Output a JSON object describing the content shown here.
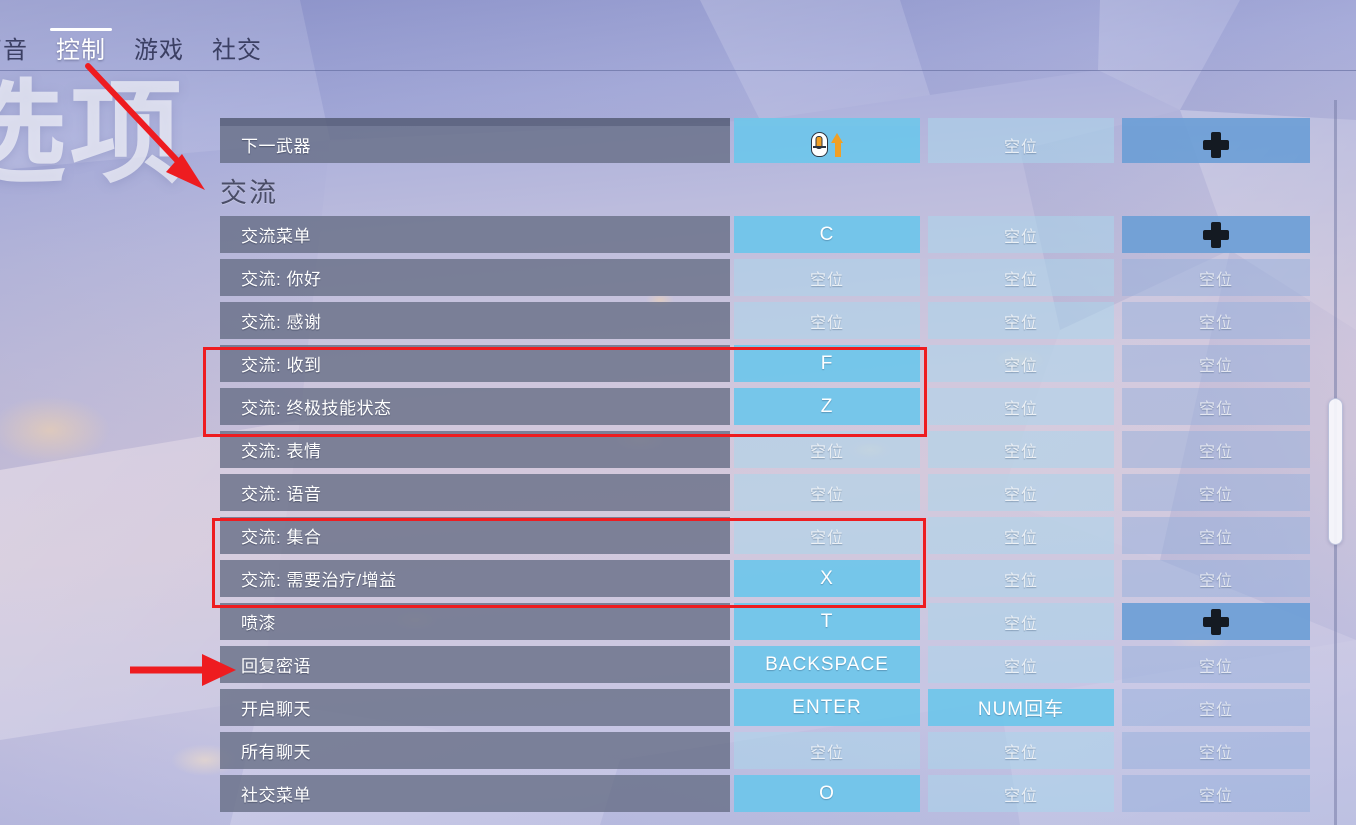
{
  "window": {
    "title": "选项"
  },
  "tabs": [
    {
      "label": "声音",
      "active": false
    },
    {
      "label": "控制",
      "active": true
    },
    {
      "label": "游戏",
      "active": false
    },
    {
      "label": "社交",
      "active": false
    }
  ],
  "empty_label": "空位",
  "icons": {
    "mouse_scroll_up": "mouse-scroll-up-icon",
    "dpad": "dpad-icon"
  },
  "colors": {
    "accent_blue": "#6ec6ea",
    "pad_blue": "#6c9ed6",
    "row_gray": "#676e86",
    "annotation_red": "#ee1c20",
    "active_tab": "#ffffff"
  },
  "partial_row_top": true,
  "rows": [
    {
      "type": "binding",
      "label": "下一武器",
      "keys": [
        {
          "kind": "icon",
          "icon": "mouse-scroll-up-icon",
          "state": "bound"
        },
        {
          "kind": "text",
          "text": "空位",
          "state": "empty"
        },
        {
          "kind": "icon",
          "icon": "dpad-icon",
          "state": "pad"
        }
      ]
    },
    {
      "type": "section",
      "label": "交流"
    },
    {
      "type": "binding",
      "label": "交流菜单",
      "keys": [
        {
          "kind": "text",
          "text": "C",
          "state": "bound"
        },
        {
          "kind": "text",
          "text": "空位",
          "state": "empty"
        },
        {
          "kind": "icon",
          "icon": "dpad-icon",
          "state": "pad"
        }
      ]
    },
    {
      "type": "binding",
      "label": "交流: 你好",
      "keys": [
        {
          "kind": "text",
          "text": "空位",
          "state": "empty"
        },
        {
          "kind": "text",
          "text": "空位",
          "state": "empty"
        },
        {
          "kind": "text",
          "text": "空位",
          "state": "empty3"
        }
      ]
    },
    {
      "type": "binding",
      "label": "交流: 感谢",
      "keys": [
        {
          "kind": "text",
          "text": "空位",
          "state": "empty"
        },
        {
          "kind": "text",
          "text": "空位",
          "state": "empty"
        },
        {
          "kind": "text",
          "text": "空位",
          "state": "empty3"
        }
      ]
    },
    {
      "type": "binding",
      "label": "交流: 收到",
      "highlighted": true,
      "keys": [
        {
          "kind": "text",
          "text": "F",
          "state": "bound"
        },
        {
          "kind": "text",
          "text": "空位",
          "state": "empty"
        },
        {
          "kind": "text",
          "text": "空位",
          "state": "empty3"
        }
      ]
    },
    {
      "type": "binding",
      "label": "交流: 终极技能状态",
      "highlighted": true,
      "keys": [
        {
          "kind": "text",
          "text": "Z",
          "state": "bound"
        },
        {
          "kind": "text",
          "text": "空位",
          "state": "empty"
        },
        {
          "kind": "text",
          "text": "空位",
          "state": "empty3"
        }
      ]
    },
    {
      "type": "binding",
      "label": "交流: 表情",
      "keys": [
        {
          "kind": "text",
          "text": "空位",
          "state": "empty"
        },
        {
          "kind": "text",
          "text": "空位",
          "state": "empty"
        },
        {
          "kind": "text",
          "text": "空位",
          "state": "empty3"
        }
      ]
    },
    {
      "type": "binding",
      "label": "交流: 语音",
      "keys": [
        {
          "kind": "text",
          "text": "空位",
          "state": "empty"
        },
        {
          "kind": "text",
          "text": "空位",
          "state": "empty"
        },
        {
          "kind": "text",
          "text": "空位",
          "state": "empty3"
        }
      ]
    },
    {
      "type": "binding",
      "label": "交流: 集合",
      "highlighted": true,
      "keys": [
        {
          "kind": "text",
          "text": "空位",
          "state": "empty"
        },
        {
          "kind": "text",
          "text": "空位",
          "state": "empty"
        },
        {
          "kind": "text",
          "text": "空位",
          "state": "empty3"
        }
      ]
    },
    {
      "type": "binding",
      "label": "交流: 需要治疗/增益",
      "highlighted": true,
      "keys": [
        {
          "kind": "text",
          "text": "X",
          "state": "bound"
        },
        {
          "kind": "text",
          "text": "空位",
          "state": "empty"
        },
        {
          "kind": "text",
          "text": "空位",
          "state": "empty3"
        }
      ]
    },
    {
      "type": "binding",
      "label": "喷漆",
      "keys": [
        {
          "kind": "text",
          "text": "T",
          "state": "bound"
        },
        {
          "kind": "text",
          "text": "空位",
          "state": "empty"
        },
        {
          "kind": "icon",
          "icon": "dpad-icon",
          "state": "pad"
        }
      ]
    },
    {
      "type": "binding",
      "label": "回复密语",
      "arrow_marked": true,
      "keys": [
        {
          "kind": "text",
          "text": "BACKSPACE",
          "state": "bound"
        },
        {
          "kind": "text",
          "text": "空位",
          "state": "empty"
        },
        {
          "kind": "text",
          "text": "空位",
          "state": "empty3"
        }
      ]
    },
    {
      "type": "binding",
      "label": "开启聊天",
      "keys": [
        {
          "kind": "text",
          "text": "ENTER",
          "state": "bound"
        },
        {
          "kind": "text",
          "text": "NUM回车",
          "state": "bound"
        },
        {
          "kind": "text",
          "text": "空位",
          "state": "empty3"
        }
      ]
    },
    {
      "type": "binding",
      "label": "所有聊天",
      "keys": [
        {
          "kind": "text",
          "text": "空位",
          "state": "empty"
        },
        {
          "kind": "text",
          "text": "空位",
          "state": "empty"
        },
        {
          "kind": "text",
          "text": "空位",
          "state": "empty3"
        }
      ]
    },
    {
      "type": "binding",
      "label": "社交菜单",
      "keys": [
        {
          "kind": "text",
          "text": "O",
          "state": "bound"
        },
        {
          "kind": "text",
          "text": "空位",
          "state": "empty"
        },
        {
          "kind": "text",
          "text": "空位",
          "state": "empty3"
        }
      ]
    }
  ],
  "annotations": [
    {
      "kind": "arrow",
      "name": "annotation-arrow-to-control-tab"
    },
    {
      "kind": "arrow",
      "name": "annotation-arrow-to-reply-whisper"
    },
    {
      "kind": "box",
      "name": "annotation-box-group-1"
    },
    {
      "kind": "box",
      "name": "annotation-box-group-2"
    }
  ],
  "scrollbar": {
    "name": "vertical-scrollbar"
  }
}
